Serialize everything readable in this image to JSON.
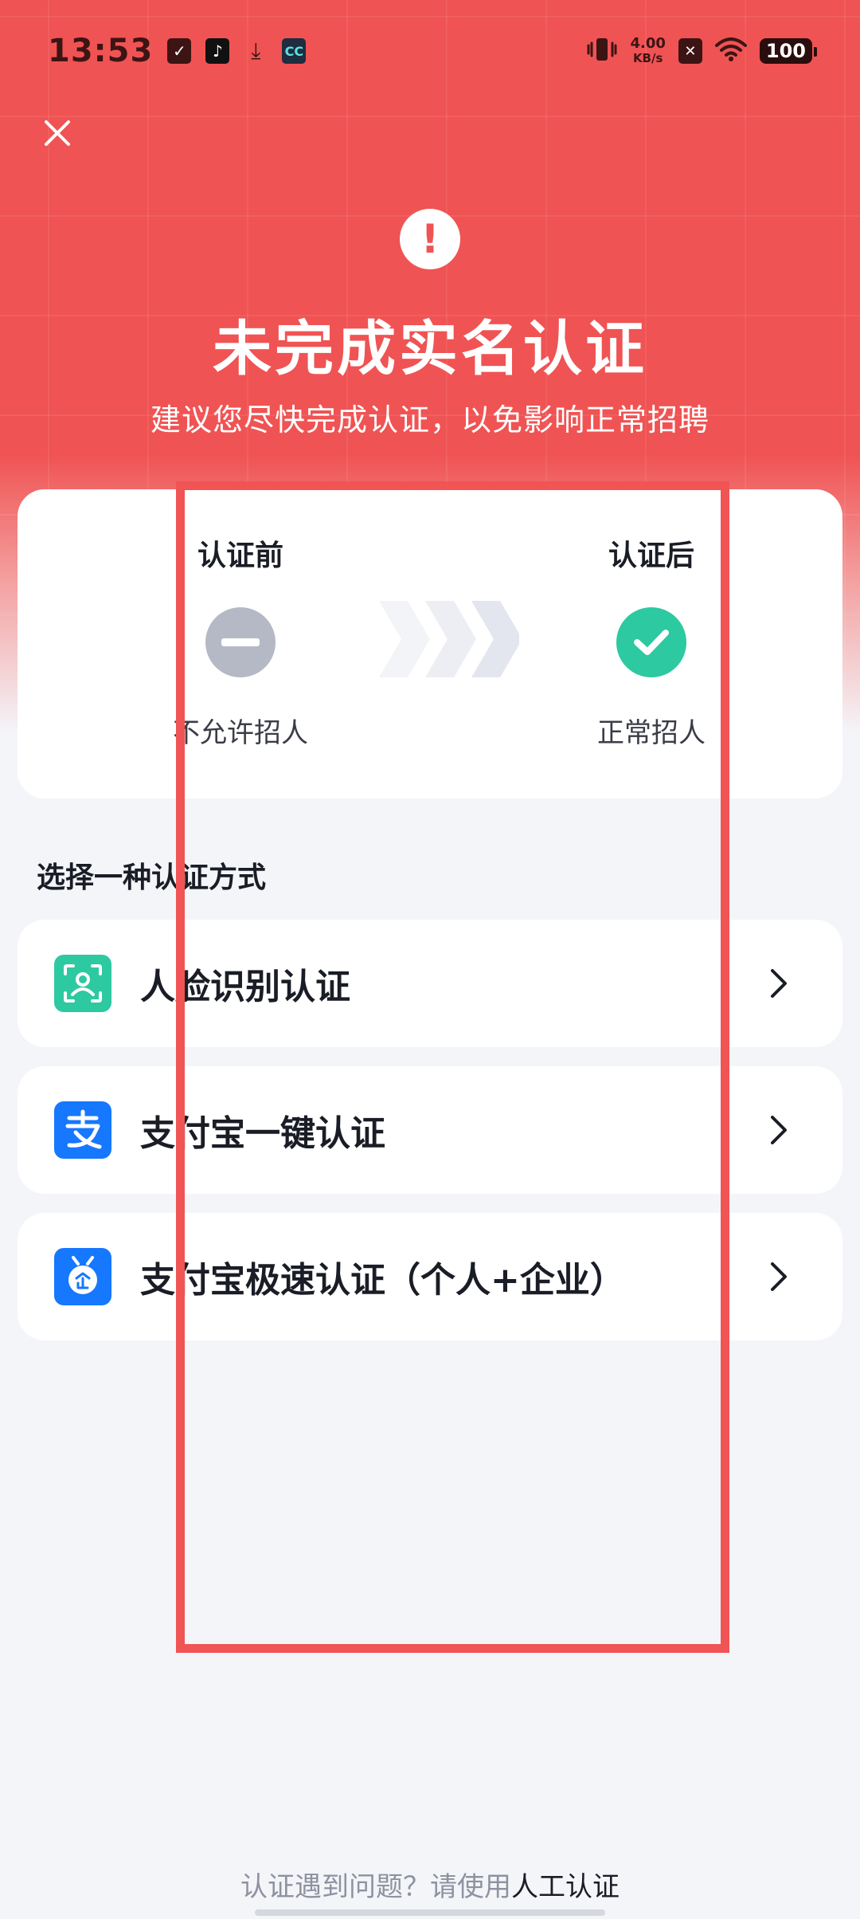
{
  "status_bar": {
    "time": "13:53",
    "net_speed_value": "4.00",
    "net_speed_unit": "KB/s",
    "battery": "100",
    "icons": [
      "notification-badge-icon",
      "tiktok-icon",
      "download-icon",
      "app-icon",
      "vibrate-icon",
      "no-sim-icon",
      "wifi-icon",
      "battery-icon"
    ]
  },
  "hero": {
    "title": "未完成实名认证",
    "subtitle": "建议您尽快完成认证，以免影响正常招聘"
  },
  "compare": {
    "before_title": "认证前",
    "before_label": "不允许招人",
    "after_title": "认证后",
    "after_label": "正常招人"
  },
  "methods": {
    "section_title": "选择一种认证方式",
    "items": [
      {
        "label": "人脸识别认证",
        "icon": "face-scan-icon",
        "color": "#2dc9a0"
      },
      {
        "label": "支付宝一键认证",
        "icon": "alipay-icon",
        "color": "#1677ff"
      },
      {
        "label": "支付宝极速认证（个人+企业）",
        "icon": "alipay-enterprise-icon",
        "color": "#1677ff"
      }
    ]
  },
  "footer": {
    "prefix": "认证遇到问题？请使用",
    "link": "人工认证"
  },
  "colors": {
    "brand_red": "#f05353",
    "success_green": "#2dc9a0",
    "alipay_blue": "#1677ff"
  }
}
